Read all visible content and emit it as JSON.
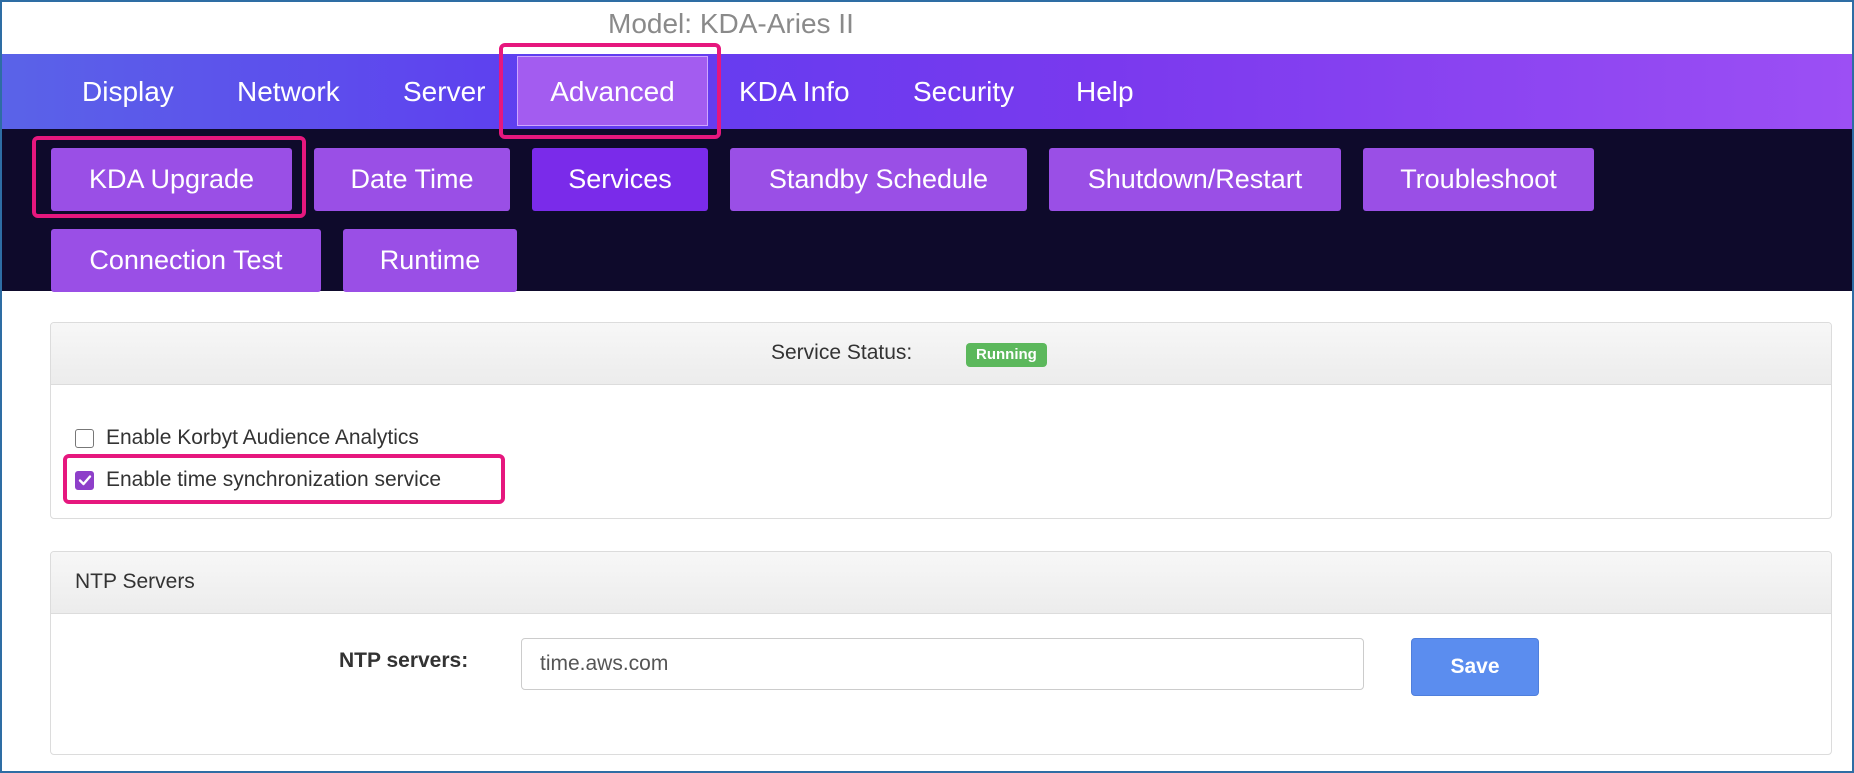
{
  "window": {
    "title": "Model: KDA-Aries II"
  },
  "top_nav": {
    "tabs": [
      {
        "label": "Display"
      },
      {
        "label": "Network"
      },
      {
        "label": "Server"
      },
      {
        "label": "Advanced",
        "active": true
      },
      {
        "label": "KDA Info"
      },
      {
        "label": "Security"
      },
      {
        "label": "Help"
      }
    ]
  },
  "sub_nav": {
    "buttons": [
      {
        "label": "KDA Upgrade"
      },
      {
        "label": "Date Time"
      },
      {
        "label": "Services",
        "active": true
      },
      {
        "label": "Standby Schedule"
      },
      {
        "label": "Shutdown/Restart"
      },
      {
        "label": "Troubleshoot"
      },
      {
        "label": "Connection Test"
      },
      {
        "label": "Runtime"
      }
    ]
  },
  "services_panel": {
    "status_label": "Service Status:",
    "status_value": "Running",
    "options": [
      {
        "label": "Enable Korbyt Audience Analytics",
        "checked": false
      },
      {
        "label": "Enable time synchronization service",
        "checked": true
      }
    ]
  },
  "ntp_panel": {
    "title": "NTP Servers",
    "field_label": "NTP servers:",
    "field_value": "time.aws.com",
    "save_label": "Save"
  },
  "colors": {
    "highlight": "#e6177e",
    "accent_purple": "#9a4fe6",
    "active_purple": "#7a2bea",
    "status_green": "#5cb85c",
    "save_blue": "#5b8def"
  }
}
